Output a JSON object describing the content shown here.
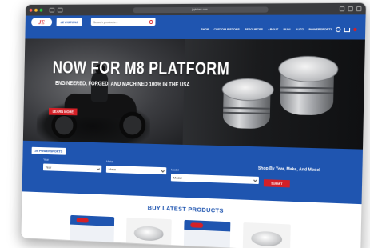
{
  "browser": {
    "url": "jepistons.com"
  },
  "header": {
    "logo_text": "JE",
    "secondary_logo_text": "JE PISTONS",
    "search_placeholder": "Search products...",
    "nav": [
      "SHOP",
      "CUSTOM PISTONS",
      "RESOURCES",
      "ABOUT",
      "BUNI",
      "AUTO",
      "POWERSPORTS"
    ]
  },
  "hero": {
    "title": "NOW FOR M8 PLATFORM",
    "subtitle": "ENGINEERED, FORGED, AND MACHINED 100% IN THE USA",
    "cta_label": "LEARN MORE"
  },
  "shop_by": {
    "brand_label": "JE POWERSPORTS",
    "year_label": "Year",
    "year_value": "Year",
    "make_label": "Make",
    "make_value": "Make",
    "model_label": "Model",
    "model_value": "Model",
    "heading": "Shop By Year, Make, And Model",
    "submit_label": "SUBMIT"
  },
  "products": {
    "title": "BUY LATEST PRODUCTS"
  },
  "colors": {
    "brand_blue": "#1f55b0",
    "brand_red": "#d42027"
  }
}
